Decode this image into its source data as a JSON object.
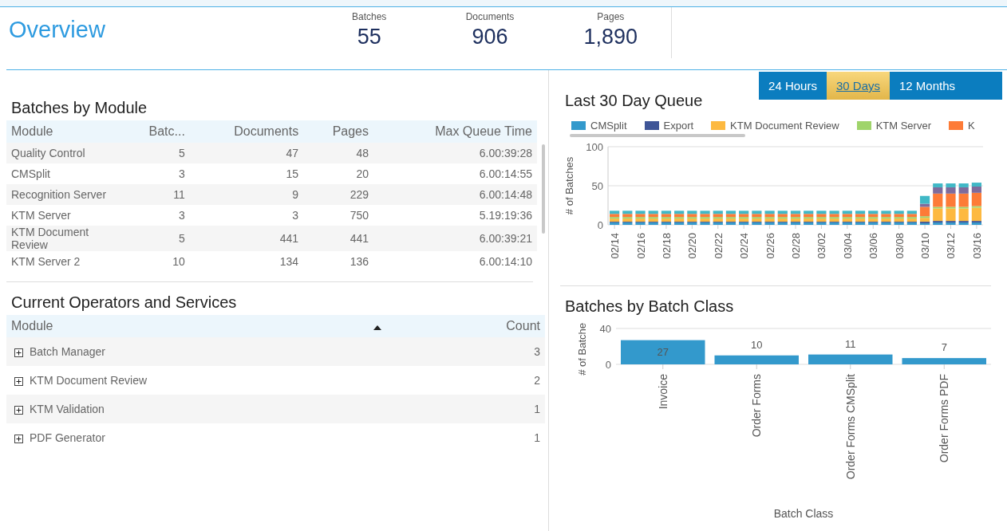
{
  "header": {
    "title": "Overview",
    "stats": [
      {
        "label": "Batches",
        "value": "55"
      },
      {
        "label": "Documents",
        "value": "906"
      },
      {
        "label": "Pages",
        "value": "1,890"
      }
    ]
  },
  "batches_by_module": {
    "title": "Batches by Module",
    "columns": [
      "Module",
      "Batc...",
      "Documents",
      "Pages",
      "Max Queue Time"
    ],
    "rows": [
      [
        "Quality Control",
        "5",
        "47",
        "48",
        "6.00:39:28"
      ],
      [
        "CMSplit",
        "3",
        "15",
        "20",
        "6.00:14:55"
      ],
      [
        "Recognition Server",
        "11",
        "9",
        "229",
        "6.00:14:48"
      ],
      [
        "KTM Server",
        "3",
        "3",
        "750",
        "5.19:19:36"
      ],
      [
        "KTM Document Review",
        "5",
        "441",
        "441",
        "6.00:39:21"
      ],
      [
        "KTM Server 2",
        "10",
        "134",
        "136",
        "6.00:14:10"
      ]
    ]
  },
  "operators": {
    "title": "Current Operators and Services",
    "columns": [
      {
        "label": "Module",
        "sort_ascending": true
      },
      {
        "label": "Count"
      }
    ],
    "rows": [
      {
        "module": "Batch Manager",
        "count": "3",
        "expanded": false
      },
      {
        "module": "KTM Document Review",
        "count": "2",
        "expanded": false
      },
      {
        "module": "KTM Validation",
        "count": "1",
        "expanded": false
      },
      {
        "module": "PDF Generator",
        "count": "1",
        "expanded": false
      }
    ]
  },
  "range_tabs": [
    {
      "label": "24 Hours",
      "selected": false
    },
    {
      "label": "30 Days",
      "selected": true
    },
    {
      "label": "12 Months",
      "selected": false
    }
  ],
  "queue": {
    "title": "Last 30 Day Queue",
    "chart_data": {
      "type": "bar",
      "stacked": true,
      "ylabel": "# of Batches",
      "ylim": [
        0,
        100
      ],
      "yticks": [
        0,
        50,
        100
      ],
      "categories": [
        "02/14",
        null,
        "02/16",
        null,
        "02/18",
        null,
        "02/20",
        null,
        "02/22",
        null,
        "02/24",
        null,
        "02/26",
        null,
        "02/28",
        null,
        "03/02",
        null,
        "03/04",
        null,
        "03/06",
        null,
        "03/08",
        null,
        "03/10",
        null,
        "03/12",
        null,
        "03/16"
      ],
      "series": [
        {
          "name": "CMSplit",
          "color": "#3399cc",
          "values": [
            3,
            3,
            3,
            3,
            3,
            3,
            3,
            3,
            3,
            3,
            3,
            3,
            3,
            3,
            3,
            3,
            3,
            3,
            3,
            3,
            3,
            3,
            3,
            3,
            2,
            3,
            3,
            3,
            3
          ]
        },
        {
          "name": "Export",
          "color": "#3f5597",
          "values": [
            1,
            1,
            1,
            1,
            1,
            1,
            1,
            1,
            1,
            1,
            1,
            1,
            1,
            1,
            1,
            1,
            1,
            1,
            1,
            1,
            1,
            1,
            1,
            1,
            2,
            2,
            2,
            2,
            2
          ]
        },
        {
          "name": "KTM Document Review",
          "color": "#fdb940",
          "values": [
            4,
            4,
            4,
            4,
            4,
            4,
            4,
            4,
            4,
            4,
            4,
            4,
            4,
            4,
            4,
            4,
            4,
            4,
            4,
            4,
            4,
            4,
            4,
            4,
            5,
            16,
            16,
            16,
            17
          ]
        },
        {
          "name": "KTM Server",
          "color": "#9fd46b",
          "values": [
            2,
            2,
            2,
            2,
            2,
            2,
            2,
            2,
            2,
            2,
            2,
            2,
            2,
            2,
            2,
            2,
            2,
            2,
            2,
            2,
            2,
            2,
            2,
            2,
            2,
            2,
            2,
            2,
            2
          ]
        },
        {
          "name": "K",
          "color": "#fd7b37",
          "values": [
            4,
            4,
            4,
            4,
            4,
            4,
            4,
            4,
            4,
            4,
            4,
            4,
            4,
            4,
            4,
            4,
            4,
            4,
            4,
            4,
            4,
            4,
            4,
            4,
            12,
            17,
            17,
            17,
            17
          ]
        },
        {
          "color": "#7e6b9c",
          "values": [
            0,
            0,
            0,
            0,
            0,
            0,
            0,
            0,
            0,
            0,
            0,
            0,
            0,
            0,
            0,
            0,
            0,
            0,
            0,
            0,
            0,
            0,
            0,
            0,
            4,
            8,
            8,
            8,
            8
          ]
        },
        {
          "color": "#40b8c6",
          "values": [
            4,
            4,
            4,
            4,
            4,
            4,
            4,
            4,
            4,
            4,
            4,
            4,
            4,
            4,
            4,
            4,
            4,
            4,
            4,
            4,
            4,
            4,
            4,
            4,
            10,
            5,
            5,
            5,
            5
          ]
        }
      ]
    }
  },
  "batch_class": {
    "title": "Batches by Batch Class",
    "chart_data": {
      "type": "bar",
      "xlabel": "Batch Class",
      "ylabel": "# of Batche",
      "ylim": [
        0,
        40
      ],
      "yticks": [
        0,
        40
      ],
      "data_labels": true,
      "categories": [
        "Invoice",
        "Order Forms",
        "Order Forms CMSplit",
        "Order Forms PDF"
      ],
      "series": [
        {
          "color": "#3399cc",
          "values": [
            27,
            10,
            11,
            7
          ]
        }
      ]
    }
  }
}
